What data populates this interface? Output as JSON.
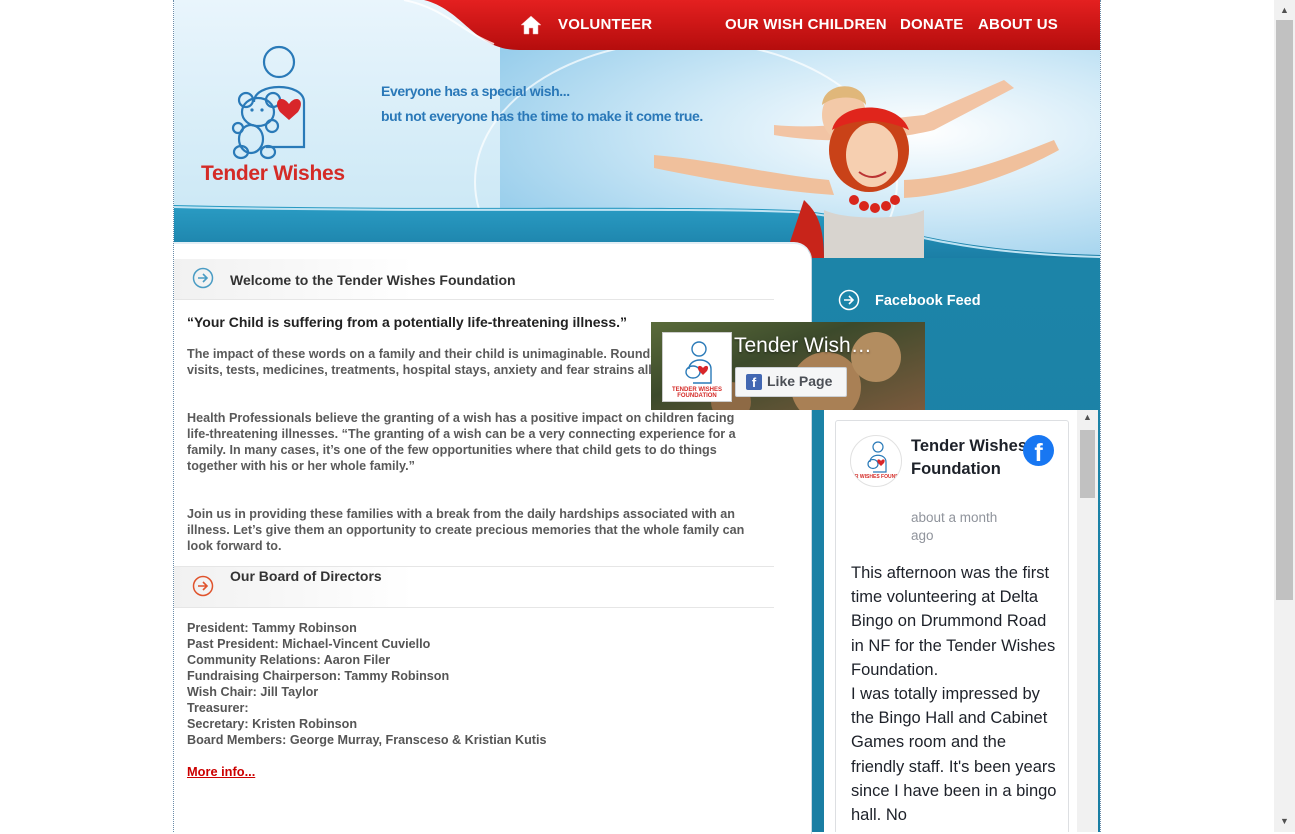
{
  "nav": {
    "volunteer": "VOLUNTEER",
    "wish_children": "OUR WISH CHILDREN",
    "donate": "DONATE",
    "about": "ABOUT US"
  },
  "brand": {
    "name": "Tender Wishes",
    "tagline_1": "Everyone has a special wish...",
    "tagline_2": "but not everyone has the time to make it come true."
  },
  "colors": {
    "nav_red": "#d01515",
    "teal": "#1a7ea3",
    "logo_red": "#d42b27",
    "link_red": "#cc0000"
  },
  "welcome": {
    "title": "Welcome to the Tender Wishes Foundation",
    "quote": "“Your Child is suffering from a potentially life-threatening illness.”",
    "para1": "The impact of these words on a family and their child is unimaginable. Rounds of doctor’s visits, tests, medicines, treatments, hospital stays, anxiety and fear strains all concerned.",
    "para2": "Health Professionals believe the granting of a wish has a positive impact on children facing life-threatening illnesses. “The granting of a wish can be a very connecting experience for a family. In many cases, it’s one of the few opportunities where that child gets to do things together with his or her whole family.”",
    "para3": "Join us in providing these families with a break from the daily hardships associated with an illness. Let’s give them an opportunity to create precious memories that the whole family can look forward to."
  },
  "board": {
    "title": "Our Board of Directors",
    "members": [
      "President: Tammy Robinson",
      "Past President: Michael-Vincent Cuviello",
      "Community Relations: Aaron Filer",
      "Fundraising Chairperson: Tammy Robinson",
      "Wish Chair: Jill Taylor",
      "Treasurer:",
      "Secretary: Kristen Robinson",
      "Board Members: George Murray, Fransceso & Kristian Kutis"
    ],
    "more_link": "More info..."
  },
  "facebook": {
    "section_title": "Facebook Feed",
    "page_name": "Tender Wish…",
    "like_label": "Like Page",
    "avatar_caption": "TENDER WISHES FOUNDATION",
    "post": {
      "author": "Tender Wishes Foundation",
      "time": "about a month ago",
      "text_1": "This afternoon was the first time volunteering at Delta Bingo on Drummond Road in NF for the Tender Wishes Foundation.",
      "text_2": "I was totally impressed by the Bingo Hall and Cabinet Games room and the friendly staff. It's been years since I have been in a bingo hall. No"
    }
  }
}
